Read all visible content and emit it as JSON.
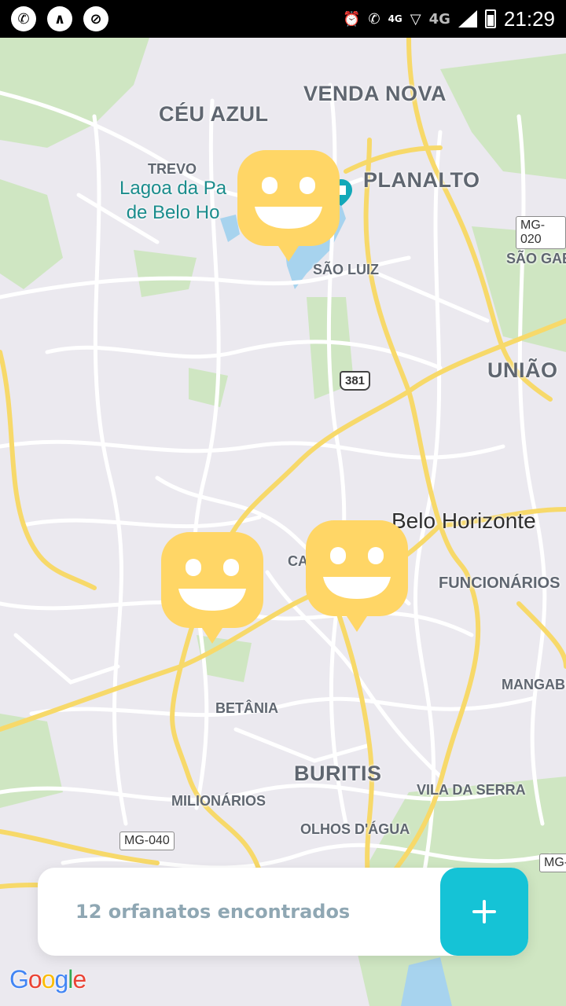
{
  "status_bar": {
    "time": "21:29",
    "network_label": "4G",
    "network_label_2": "4G",
    "left_icons": [
      "whatsapp-icon",
      "app-notification-icon",
      "blocked-icon"
    ],
    "right_icons": [
      "alarm-icon",
      "call-icon",
      "wifi-icon",
      "signal-icon",
      "battery-icon"
    ]
  },
  "map": {
    "neighborhoods": [
      {
        "name": "CÉU AZUL",
        "size": "big"
      },
      {
        "name": "VENDA NOVA",
        "size": "big"
      },
      {
        "name": "TREVO",
        "size": "med"
      },
      {
        "name": "PLANALTO",
        "size": "big"
      },
      {
        "name": "SÃO LUIZ",
        "size": "med"
      },
      {
        "name": "SÃO GABI",
        "size": "med"
      },
      {
        "name": "UNIÃO",
        "size": "big"
      },
      {
        "name": "FUNCIONÁRIOS",
        "size": "med"
      },
      {
        "name": "MANGABE",
        "size": "med"
      },
      {
        "name": "BETÂNIA",
        "size": "med"
      },
      {
        "name": "BURITIS",
        "size": "big"
      },
      {
        "name": "VILA DA SERRA",
        "size": "med"
      },
      {
        "name": "MILIONÁRIOS",
        "size": "med"
      },
      {
        "name": "OLHOS D'ÁGUA",
        "size": "med"
      },
      {
        "name": "CA",
        "size": "med"
      }
    ],
    "city": "Belo Horizonte",
    "lake_label_line1": "Lagoa da Pa",
    "lake_label_line2": "de Belo Ho",
    "road_shields": [
      "MG-020",
      "381",
      "MG-040",
      "MG-"
    ],
    "markers": [
      {
        "name": "orphanage-marker-1",
        "icon": "smile-icon"
      },
      {
        "name": "orphanage-marker-2",
        "icon": "smile-icon"
      },
      {
        "name": "orphanage-marker-3",
        "icon": "smile-icon"
      }
    ],
    "colors": {
      "background": "#ebe9ef",
      "road": "#ffffff",
      "highway": "#f7d96a",
      "park": "#cfe6c2",
      "water": "#a7d3ee",
      "marker": "#ffd666",
      "accent": "#15c3d6"
    }
  },
  "footer": {
    "count_text": "12 orfanatos encontrados",
    "add_icon": "plus-icon"
  },
  "attribution": {
    "logo_text": "Google"
  }
}
